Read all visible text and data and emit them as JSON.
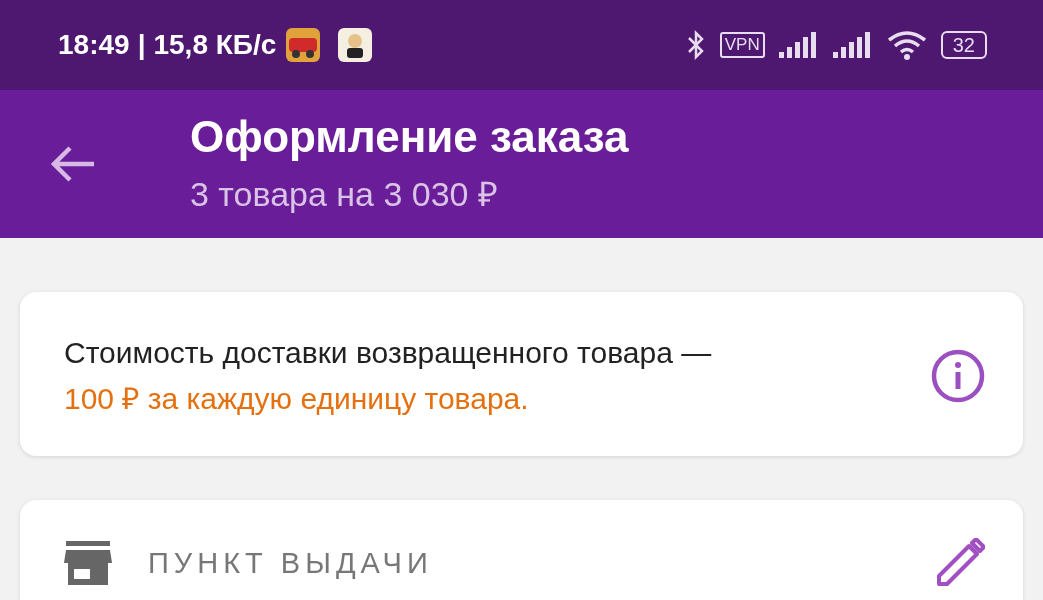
{
  "status_bar": {
    "time": "18:49",
    "separator": "|",
    "speed": "15,8 КБ/с",
    "vpn_label": "VPN",
    "battery": "32"
  },
  "header": {
    "title": "Оформление заказа",
    "subtitle": "3 товара на 3 030 ₽"
  },
  "notice": {
    "text": "Стоимость доставки возвращенного товара —",
    "highlight": "100 ₽ за каждую единицу товара."
  },
  "pickup_section": {
    "label": "ПУНКТ ВЫДАЧИ"
  }
}
